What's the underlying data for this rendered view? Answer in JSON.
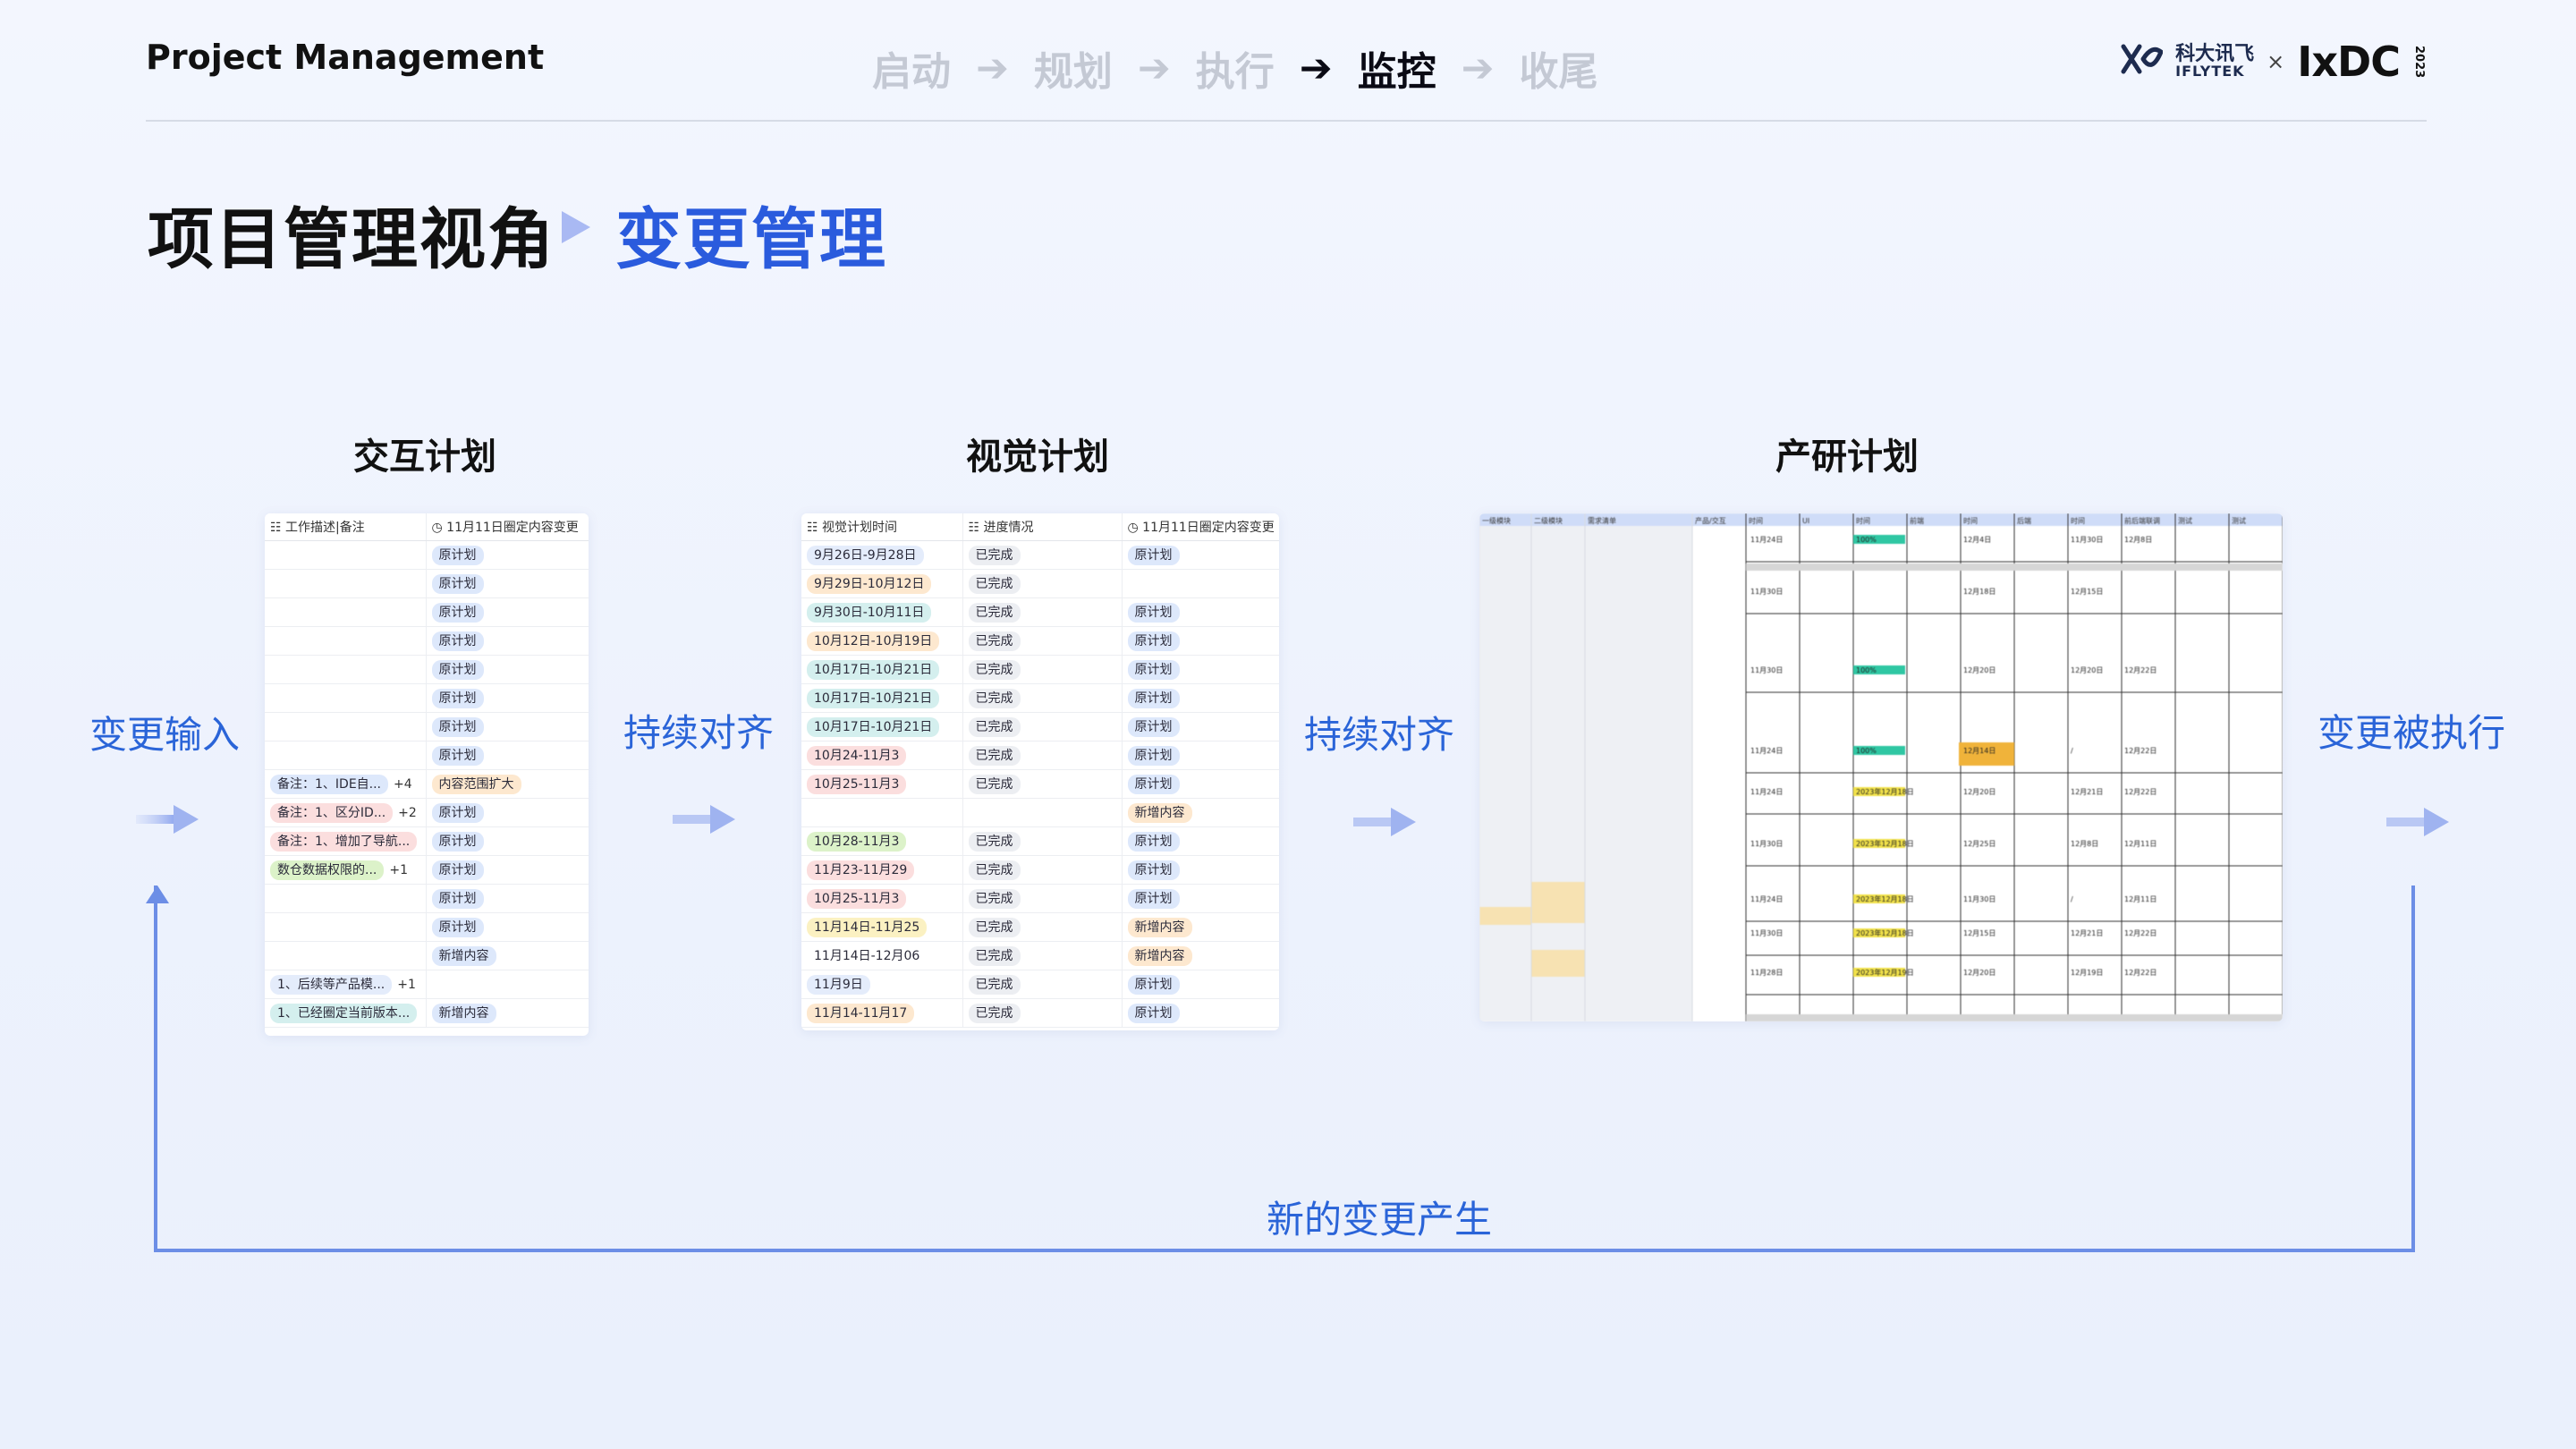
{
  "header": {
    "project": "Project Management",
    "steps": [
      "启动",
      "规划",
      "执行",
      "监控",
      "收尾"
    ],
    "active_step": 3,
    "arrow_glyph": "➔",
    "logo": {
      "cn": "科大讯飞",
      "en": "IFLYTEK",
      "x": "×",
      "ixdc": "IxDC",
      "year": "2023"
    }
  },
  "title": {
    "main": "项目管理视角",
    "sub": "变更管理"
  },
  "sections": {
    "interaction": "交互计划",
    "visual": "视觉计划",
    "rd": "产研计划"
  },
  "flow": {
    "input": "变更输入",
    "align1": "持续对齐",
    "align2": "持续对齐",
    "executed": "变更被执行",
    "new_change": "新的变更产生"
  },
  "interaction_table": {
    "headers": [
      "工作描述|备注",
      "11月11日圈定内容变更"
    ],
    "rows": [
      {
        "note": "",
        "more": "",
        "change": "原计划"
      },
      {
        "note": "",
        "more": "",
        "change": "原计划"
      },
      {
        "note": "",
        "more": "",
        "change": "原计划"
      },
      {
        "note": "",
        "more": "",
        "change": "原计划"
      },
      {
        "note": "",
        "more": "",
        "change": "原计划"
      },
      {
        "note": "",
        "more": "",
        "change": "原计划"
      },
      {
        "note": "",
        "more": "",
        "change": "原计划"
      },
      {
        "note": "",
        "more": "",
        "change": "原计划"
      },
      {
        "note": "备注：1、IDE自...",
        "more": "+4",
        "change": "内容范围扩大",
        "note_color": "blue",
        "change_color": "orange"
      },
      {
        "note": "备注：1、区分ID...",
        "more": "+2",
        "change": "原计划",
        "note_color": "pink"
      },
      {
        "note": "备注：1、增加了导航...",
        "more": "",
        "change": "原计划",
        "note_color": "pink"
      },
      {
        "note": "数仓数据权限的...",
        "more": "+1",
        "change": "原计划",
        "note_color": "green"
      },
      {
        "note": "",
        "more": "",
        "change": "原计划"
      },
      {
        "note": "",
        "more": "",
        "change": "原计划"
      },
      {
        "note": "",
        "more": "",
        "change": "新增内容"
      },
      {
        "note": "1、后续等产品模...",
        "more": "+1",
        "change": "",
        "note_color": "light"
      },
      {
        "note": "1、已经圈定当前版本...",
        "more": "",
        "change": "新增内容",
        "note_color": "teal"
      }
    ]
  },
  "visual_table": {
    "headers": [
      "视觉计划时间",
      "进度情况",
      "11月11日圈定内容变更"
    ],
    "rows": [
      {
        "time": "9月26日-9月28日",
        "tc": "light",
        "status": "已完成",
        "change": "原计划"
      },
      {
        "time": "9月29日-10月12日",
        "tc": "orange",
        "status": "已完成",
        "change": ""
      },
      {
        "time": "9月30日-10月11日",
        "tc": "teal",
        "status": "已完成",
        "change": "原计划"
      },
      {
        "time": "10月12日-10月19日",
        "tc": "orange",
        "status": "已完成",
        "change": "原计划"
      },
      {
        "time": "10月17日-10月21日",
        "tc": "teal",
        "status": "已完成",
        "change": "原计划"
      },
      {
        "time": "10月17日-10月21日",
        "tc": "teal",
        "status": "已完成",
        "change": "原计划"
      },
      {
        "time": "10月17日-10月21日",
        "tc": "teal",
        "status": "已完成",
        "change": "原计划"
      },
      {
        "time": "10月24-11月3",
        "tc": "pink",
        "status": "已完成",
        "change": "原计划"
      },
      {
        "time": "10月25-11月3",
        "tc": "pink",
        "status": "已完成",
        "change": "原计划"
      },
      {
        "time": "",
        "tc": "",
        "status": "",
        "change": "新增内容"
      },
      {
        "time": "10月28-11月3",
        "tc": "green",
        "status": "已完成",
        "change": "原计划"
      },
      {
        "time": "11月23-11月29",
        "tc": "pink",
        "status": "已完成",
        "change": "原计划"
      },
      {
        "time": "10月25-11月3",
        "tc": "pink",
        "status": "已完成",
        "change": "原计划"
      },
      {
        "time": "11月14日-11月25",
        "tc": "yellow",
        "status": "已完成",
        "change": "新增内容"
      },
      {
        "time": "11月14日-12月06",
        "tc": "",
        "status": "已完成",
        "change": "新增内容"
      },
      {
        "time": "11月9日",
        "tc": "light",
        "status": "已完成",
        "change": "原计划"
      },
      {
        "time": "11月14-11月17",
        "tc": "orange",
        "status": "已完成",
        "change": "原计划"
      }
    ]
  },
  "rd_sheet": {
    "headers": [
      "一级模块",
      "二级模块",
      "需求清单",
      "产品/交互",
      "时间",
      "UI",
      "时间",
      "前端",
      "时间",
      "后端",
      "时间",
      "前后端联调",
      "测试",
      "测试"
    ],
    "rows": [
      [
        "11月24日",
        "100%",
        "12月4日",
        "11月30日",
        "12月8日"
      ],
      [
        "11月30日",
        "",
        "12月18日",
        "12月15日",
        ""
      ],
      [
        "11月30日",
        "100%",
        "12月20日",
        "12月20日",
        "12月22日"
      ],
      [
        "11月24日",
        "100%",
        "12月14日",
        "/",
        "12月22日"
      ],
      [
        "11月24日",
        "2023年12月18日",
        "12月20日",
        "12月21日",
        "12月22日"
      ],
      [
        "11月30日",
        "2023年12月18日",
        "12月25日",
        "12月8日",
        "12月11日"
      ],
      [
        "11月24日",
        "2023年12月18日",
        "11月30日",
        "/",
        "12月11日"
      ],
      [
        "11月30日",
        "2023年12月18日",
        "12月15日",
        "12月21日",
        "12月22日"
      ],
      [
        "11月28日",
        "2023年12月19日",
        "12月20日",
        "12月19日",
        "12月22日"
      ]
    ]
  },
  "colors": {
    "accent": "#2a5bdd",
    "flow": "#2a64d8",
    "loop": "#6c8ee6",
    "arrow": "#a9b9f3"
  }
}
